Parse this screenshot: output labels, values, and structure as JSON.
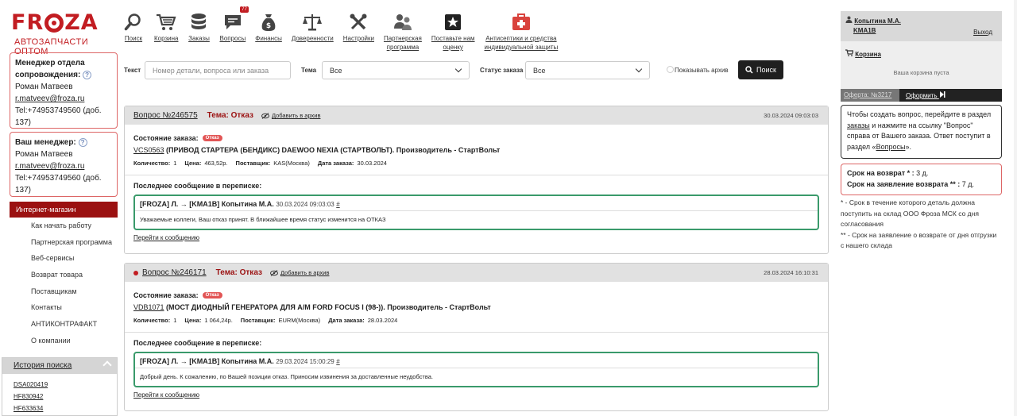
{
  "logo": {
    "word_1": "FR",
    "word_2": "ZA",
    "subtitle": "АВТОЗАПЧАСТИ ОПТОМ"
  },
  "nav": [
    {
      "label": "Поиск",
      "icon": "search-icon"
    },
    {
      "label": "Корзина",
      "icon": "cart-icon"
    },
    {
      "label": "Заказы",
      "icon": "database-icon"
    },
    {
      "label": "Вопросы",
      "icon": "chat-icon",
      "badge": "77"
    },
    {
      "label": "Финансы",
      "icon": "money-bag-icon"
    },
    {
      "label": "Доверенности",
      "icon": "scales-icon"
    },
    {
      "label": "Настройки",
      "icon": "tools-icon"
    },
    {
      "label": "Партнерская\nпрограмма",
      "icon": "partners-icon"
    },
    {
      "label": "Поставьте нам\nоценку",
      "icon": "star-icon"
    },
    {
      "label": "Антисептики и средства\nиндивидуальной защиты",
      "icon": "first-aid-icon"
    }
  ],
  "manager_support": {
    "title": "Менеджер отдела сопровождения:",
    "name": "Роман Матвеев",
    "email": "r.matveev@froza.ru",
    "phone": "Tel:+74953749560 (доб. 137)"
  },
  "manager_yours": {
    "title": "Ваш менеджер:",
    "name": "Роман Матвеев",
    "email": "r.matveev@froza.ru",
    "phone": "Tel:+74953749560 (доб. 137)"
  },
  "menu": {
    "head": "Интернет-магазин",
    "items": [
      "Как начать работу",
      "Партнерская программа",
      "Веб-сервисы",
      "Возврат товара",
      "Поставщикам",
      "Контакты",
      "АНТИКОНТРАФАКТ",
      "О компании"
    ]
  },
  "history": {
    "title": "История поиска",
    "items": [
      "DSA020419",
      "HF830942",
      "HF633634"
    ]
  },
  "filters": {
    "text_label": "Текст",
    "text_placeholder": "Номер детали, вопроса или заказа",
    "theme_label": "Тема",
    "theme_value": "Все",
    "status_label": "Статус заказа",
    "status_value": "Все",
    "archive_label": "Показывать архив",
    "search_label": "Поиск"
  },
  "questions": [
    {
      "number": "Вопрос №246575",
      "theme": "Тема: Отказ",
      "archive": "Добавить в архив",
      "date": "30.03.2024 09:03:03",
      "state_label": "Состояние заказа:",
      "state_pill": "Отказ",
      "part_code": "VCS0563",
      "part_desc": " (ПРИВОД СТАРТЕРА (БЕНДИКС) DAEWOO NEXIA (СТАРТВОЛЬТ). Производитель - СтартВольт",
      "qty_label": "Количество:",
      "qty": "1",
      "price_label": "Цена:",
      "price": "463,52р.",
      "supplier_label": "Поставщик:",
      "supplier": "KAS(Москва)",
      "order_date_label": "Дата заказа:",
      "order_date": "30.03.2024",
      "last_label": "Последнее сообщение в переписке:",
      "msg_from": "[FROZA] Л. → [KMA1B] Копытина М.А.",
      "msg_time": "30.03.2024 09:03:03",
      "msg_hash": "#",
      "msg_text": "Уважаемые коллеги, Ваш отказ принят. В ближайшее время статус изменится на ОТКАЗ",
      "goto": "Перейти к сообщению"
    },
    {
      "number": "Вопрос №246171",
      "theme": "Тема: Отказ",
      "archive": "Добавить в архив",
      "date": "28.03.2024 16:10:31",
      "state_label": "Состояние заказа:",
      "state_pill": "Отказ",
      "part_code": "VDB1071",
      "part_desc": " (МОСТ ДИОДНЫЙ ГЕНЕРАТОРА ДЛЯ А/М FORD FOCUS I (98-)). Производитель - СтартВольт",
      "qty_label": "Количество:",
      "qty": "1",
      "price_label": "Цена:",
      "price": "1 064,24р.",
      "supplier_label": "Поставщик:",
      "supplier": "EURM(Москва)",
      "order_date_label": "Дата заказа:",
      "order_date": "28.03.2024",
      "last_label": "Последнее сообщение в переписке:",
      "msg_from": "[FROZA] Л. → [KMA1B] Копытина М.А.",
      "msg_time": "29.03.2024 15:00:29",
      "msg_hash": "#",
      "msg_text": "Добрый день. К сожалению, по Вашей позиции отказ. Приносим извинения за доставленные неудобства.",
      "goto": "Перейти к сообщению"
    }
  ],
  "user": {
    "name": "Копытина М.А.",
    "login": "KMA1B",
    "exit": "Выход"
  },
  "cart": {
    "title": "Корзина",
    "empty": "Ваша корзина пуста",
    "offer": "Оферта: №3217",
    "checkout": "Оформить"
  },
  "info": {
    "text_1": "Чтобы создать вопрос, перейдите в раздел ",
    "link_1": "заказы",
    "text_2": " и нажмите на ссылку \"Вопрос\" справа от Вашего заказа. Ответ поступит в раздел «",
    "link_2": "Вопросы",
    "text_3": "»."
  },
  "terms": {
    "return_label": "Срок на возврат * :",
    "return_value": "3 д.",
    "claim_label": "Срок на заявление возврата ** :",
    "claim_value": "7 д."
  },
  "notes": [
    "* - Срок в течение которого деталь должна поступить на склад ООО Фроза МСК со дня согласования",
    "** - Срок на заявление о возврате от дня отгрузки с нашего склада"
  ],
  "colors": {
    "brand_red": "#c21d22",
    "menu_red": "#9b1111",
    "message_border": "#3a9a6b"
  }
}
